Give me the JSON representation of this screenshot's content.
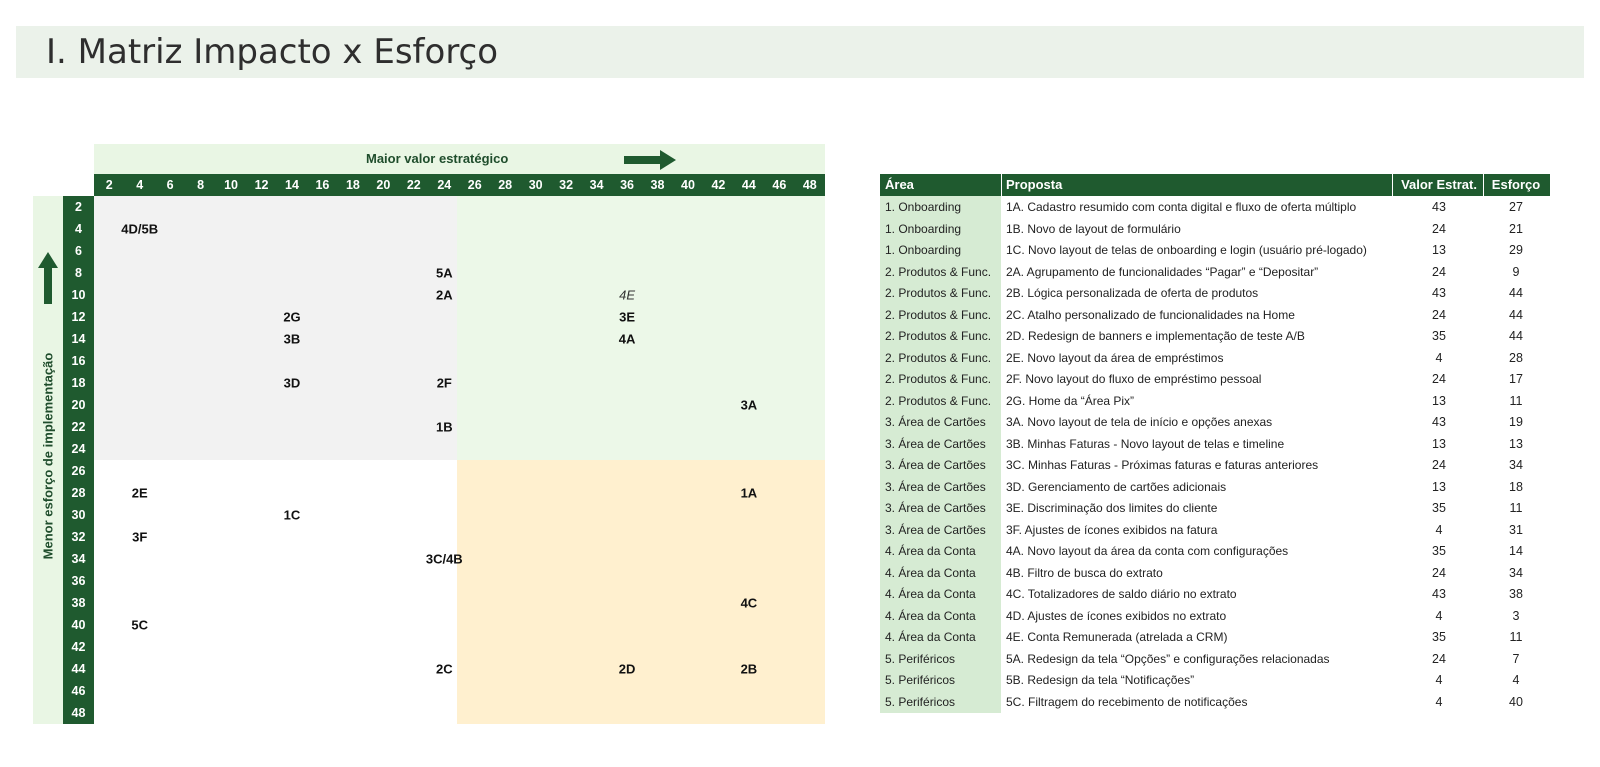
{
  "page": {
    "title": "I. Matriz Impacto x Esforço"
  },
  "matrix": {
    "x_axis_label": "Maior valor estratégico",
    "y_axis_label": "Menor esforço de implementação",
    "x_ticks": [
      "2",
      "4",
      "6",
      "8",
      "10",
      "12",
      "14",
      "16",
      "18",
      "20",
      "22",
      "24",
      "26",
      "28",
      "30",
      "32",
      "34",
      "36",
      "38",
      "40",
      "42",
      "44",
      "46",
      "48"
    ],
    "y_ticks": [
      "2",
      "4",
      "6",
      "8",
      "10",
      "12",
      "14",
      "16",
      "18",
      "20",
      "22",
      "24",
      "26",
      "28",
      "30",
      "32",
      "34",
      "36",
      "38",
      "40",
      "42",
      "44",
      "46",
      "48"
    ],
    "colors": {
      "header": "#1f5a2f",
      "banner": "#e9f6e4",
      "quad_top_left": "#f2f2f2",
      "quad_top_right": "#ecf8e8",
      "quad_bottom_left": "#ffffff",
      "quad_bottom_right": "#fff0cf"
    }
  },
  "chart_data": {
    "type": "scatter",
    "title": "",
    "xlabel": "Maior valor estratégico",
    "ylabel": "Menor esforço de implementação",
    "xlim": [
      2,
      48
    ],
    "ylim": [
      2,
      48
    ],
    "y_inverted": true,
    "points": [
      {
        "label": "4D/5B",
        "x": 4,
        "y": 4
      },
      {
        "label": "5A",
        "x": 24,
        "y": 8
      },
      {
        "label": "2A",
        "x": 24,
        "y": 10
      },
      {
        "label": "4E",
        "x": 36,
        "y": 10,
        "italic": true
      },
      {
        "label": "2G",
        "x": 14,
        "y": 12
      },
      {
        "label": "3E",
        "x": 36,
        "y": 12
      },
      {
        "label": "3B",
        "x": 14,
        "y": 14
      },
      {
        "label": "4A",
        "x": 36,
        "y": 14
      },
      {
        "label": "3D",
        "x": 14,
        "y": 18
      },
      {
        "label": "2F",
        "x": 24,
        "y": 18
      },
      {
        "label": "3A",
        "x": 44,
        "y": 20
      },
      {
        "label": "1B",
        "x": 24,
        "y": 22
      },
      {
        "label": "2E",
        "x": 4,
        "y": 28
      },
      {
        "label": "1A",
        "x": 44,
        "y": 28
      },
      {
        "label": "1C",
        "x": 14,
        "y": 30
      },
      {
        "label": "3F",
        "x": 4,
        "y": 32
      },
      {
        "label": "3C/4B",
        "x": 24,
        "y": 34
      },
      {
        "label": "4C",
        "x": 44,
        "y": 38
      },
      {
        "label": "5C",
        "x": 4,
        "y": 40
      },
      {
        "label": "2C",
        "x": 24,
        "y": 44
      },
      {
        "label": "2D",
        "x": 36,
        "y": 44
      },
      {
        "label": "2B",
        "x": 44,
        "y": 44
      }
    ]
  },
  "table": {
    "headers": {
      "area": "Área",
      "proposal": "Proposta",
      "value": "Valor Estrat.",
      "effort": "Esforço"
    },
    "rows": [
      {
        "area": "1. Onboarding",
        "proposal": "1A. Cadastro resumido com conta digital e fluxo de oferta múltiplo",
        "value": "43",
        "effort": "27"
      },
      {
        "area": "1. Onboarding",
        "proposal": "1B. Novo de layout de formulário",
        "value": "24",
        "effort": "21"
      },
      {
        "area": "1. Onboarding",
        "proposal": "1C. Novo layout de telas de onboarding e login (usuário pré-logado)",
        "value": "13",
        "effort": "29"
      },
      {
        "area": "2. Produtos & Func.",
        "proposal": "2A. Agrupamento de funcionalidades “Pagar” e “Depositar”",
        "value": "24",
        "effort": "9"
      },
      {
        "area": "2. Produtos & Func.",
        "proposal": "2B. Lógica personalizada de oferta de produtos",
        "value": "43",
        "effort": "44"
      },
      {
        "area": "2. Produtos & Func.",
        "proposal": "2C. Atalho personalizado de funcionalidades na Home",
        "value": "24",
        "effort": "44"
      },
      {
        "area": "2. Produtos & Func.",
        "proposal": "2D. Redesign de banners e implementação de teste A/B",
        "value": "35",
        "effort": "44"
      },
      {
        "area": "2. Produtos & Func.",
        "proposal": "2E. Novo layout da área de empréstimos",
        "value": "4",
        "effort": "28"
      },
      {
        "area": "2. Produtos & Func.",
        "proposal": "2F. Novo layout do fluxo de empréstimo pessoal",
        "value": "24",
        "effort": "17"
      },
      {
        "area": "2. Produtos & Func.",
        "proposal": "2G. Home da “Área Pix”",
        "value": "13",
        "effort": "11"
      },
      {
        "area": "3. Área de Cartões",
        "proposal": "3A. Novo layout de tela de início e opções anexas",
        "value": "43",
        "effort": "19"
      },
      {
        "area": "3. Área de Cartões",
        "proposal": "3B. Minhas Faturas - Novo layout de telas e timeline",
        "value": "13",
        "effort": "13"
      },
      {
        "area": "3. Área de Cartões",
        "proposal": "3C. Minhas Faturas - Próximas faturas e faturas anteriores",
        "value": "24",
        "effort": "34"
      },
      {
        "area": "3. Área de Cartões",
        "proposal": "3D. Gerenciamento de cartões adicionais",
        "value": "13",
        "effort": "18"
      },
      {
        "area": "3. Área de Cartões",
        "proposal": "3E. Discriminação dos limites do cliente",
        "value": "35",
        "effort": "11"
      },
      {
        "area": "3. Área de Cartões",
        "proposal": "3F. Ajustes de ícones exibidos na fatura",
        "value": "4",
        "effort": "31"
      },
      {
        "area": "4. Área da Conta",
        "proposal": "4A. Novo layout da área da conta com configurações",
        "value": "35",
        "effort": "14"
      },
      {
        "area": "4. Área da Conta",
        "proposal": "4B. Filtro de busca do extrato",
        "value": "24",
        "effort": "34"
      },
      {
        "area": "4. Área da Conta",
        "proposal": "4C. Totalizadores de saldo diário no extrato",
        "value": "43",
        "effort": "38"
      },
      {
        "area": "4. Área da Conta",
        "proposal": "4D. Ajustes de ícones exibidos no extrato",
        "value": "4",
        "effort": "3"
      },
      {
        "area": "4. Área da Conta",
        "proposal": "4E. Conta Remunerada (atrelada a CRM)",
        "value": "35",
        "effort": "11"
      },
      {
        "area": "5. Periféricos",
        "proposal": "5A. Redesign da tela “Opções” e configurações relacionadas",
        "value": "24",
        "effort": "7"
      },
      {
        "area": "5. Periféricos",
        "proposal": "5B. Redesign da tela “Notificações”",
        "value": "4",
        "effort": "4"
      },
      {
        "area": "5. Periféricos",
        "proposal": "5C. Filtragem do recebimento de notificações",
        "value": "4",
        "effort": "40"
      }
    ]
  }
}
